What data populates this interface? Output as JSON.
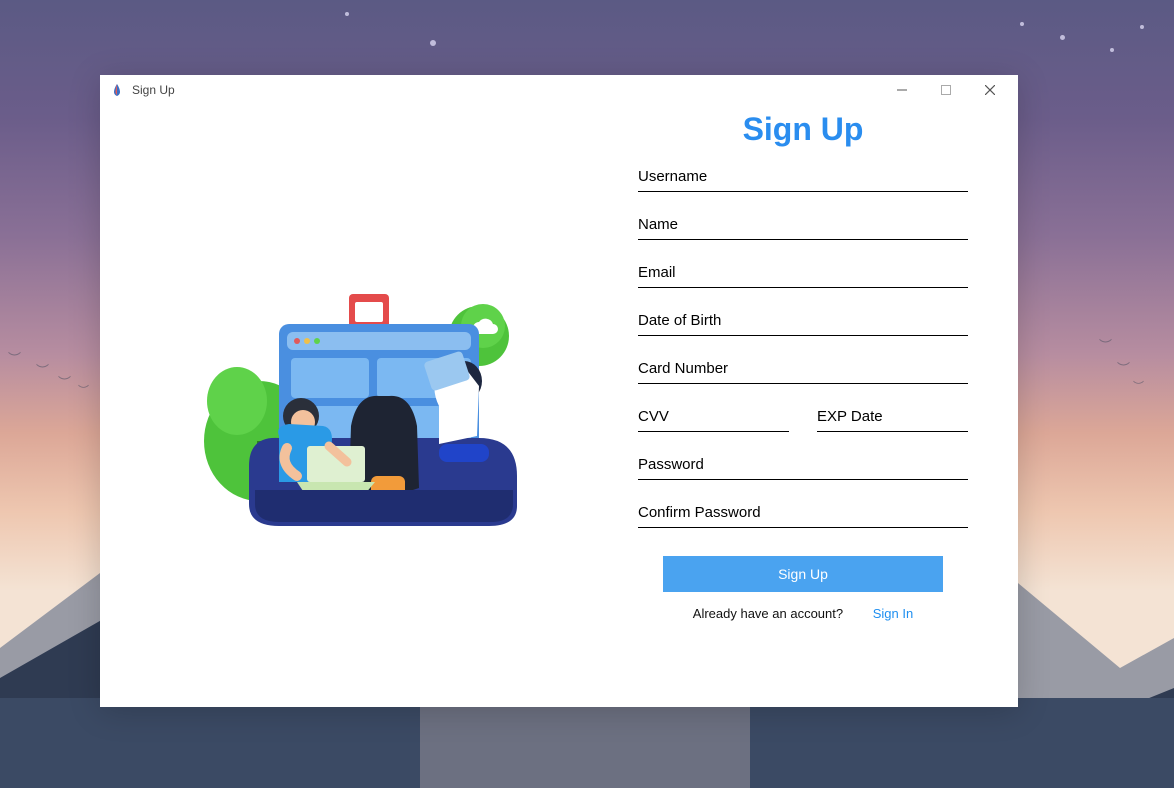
{
  "window": {
    "title": "Sign Up"
  },
  "form": {
    "heading": "Sign Up",
    "fields": {
      "username_placeholder": "Username",
      "name_placeholder": "Name",
      "email_placeholder": "Email",
      "dob_placeholder": "Date of Birth",
      "card_placeholder": "Card Number",
      "cvv_placeholder": "CVV",
      "exp_placeholder": "EXP Date",
      "password_placeholder": "Password",
      "confirm_placeholder": "Confirm Password"
    },
    "submit_label": "Sign Up",
    "already_text": "Already have an account?",
    "signin_label": "Sign In"
  },
  "colors": {
    "accent": "#4aa3f0",
    "heading": "#2a8def"
  }
}
